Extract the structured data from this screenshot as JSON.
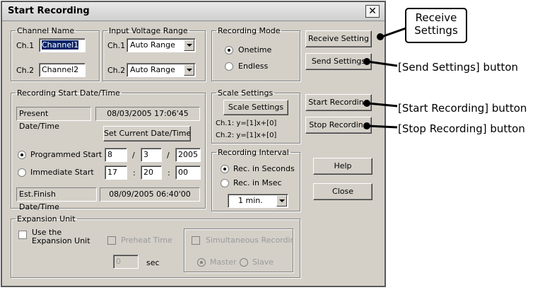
{
  "dialog": {
    "title": "Start Recording",
    "close_symbol": "✕"
  },
  "channel_name": {
    "legend": "Channel Name",
    "ch1_label": "Ch.1",
    "ch1_value": "Channel1",
    "ch2_label": "Ch.2",
    "ch2_value": "Channel2"
  },
  "input_voltage": {
    "legend": "Input Voltage Range",
    "ch1_label": "Ch.1",
    "ch1_value": "Auto Range",
    "ch2_label": "Ch.2",
    "ch2_value": "Auto Range"
  },
  "recording_mode": {
    "legend": "Recording Mode",
    "options": [
      "Onetime",
      "Endless"
    ],
    "selected": "Onetime"
  },
  "start_datetime": {
    "legend": "Recording Start Date/Time",
    "present_label": "Present Date/Time",
    "present_value": "08/03/2005 17:06'45",
    "set_current_label": "Set Current Date/Time",
    "programmed_label": "Programmed Start",
    "immediate_label": "Immediate Start",
    "selected": "Programmed Start",
    "date_month": "8",
    "date_day": "3",
    "date_year": "2005",
    "date_sep": "/",
    "time_hour": "17",
    "time_min": "20",
    "time_sec": "00",
    "time_sep": ":",
    "finish_label": "Est.Finish Date/Time",
    "finish_value": "08/09/2005 06:40'00"
  },
  "scale_settings": {
    "legend": "Scale Settings",
    "button_label": "Scale Settings",
    "ch1_formula": "Ch.1: y=[1]x+[0]",
    "ch2_formula": "Ch.2: y=[1]x+[0]"
  },
  "recording_interval": {
    "legend": "Recording Interval",
    "options": [
      "Rec. in Seconds",
      "Rec. in Msec"
    ],
    "selected": "Rec. in Seconds",
    "interval_value": "1 min."
  },
  "expansion_unit": {
    "legend": "Expansion Unit",
    "use_label_1": "Use the",
    "use_label_2": "Expansion Unit",
    "preheat_label": "Preheat Time",
    "preheat_value": "0",
    "preheat_unit": "sec",
    "simultaneous_label": "Simultaneous Recordir",
    "master_label": "Master",
    "slave_label": "Slave"
  },
  "side_buttons": {
    "receive": "Receive Setting",
    "send": "Send Settings",
    "start": "Start Recording",
    "stop": "Stop Recording",
    "help": "Help",
    "close": "Close"
  },
  "annotations": {
    "receive_callout_1": "Receive",
    "receive_callout_2": "Settings",
    "send": "[Send Settings] button",
    "start": "[Start Recording] button",
    "stop": "[Stop Recording] button"
  }
}
